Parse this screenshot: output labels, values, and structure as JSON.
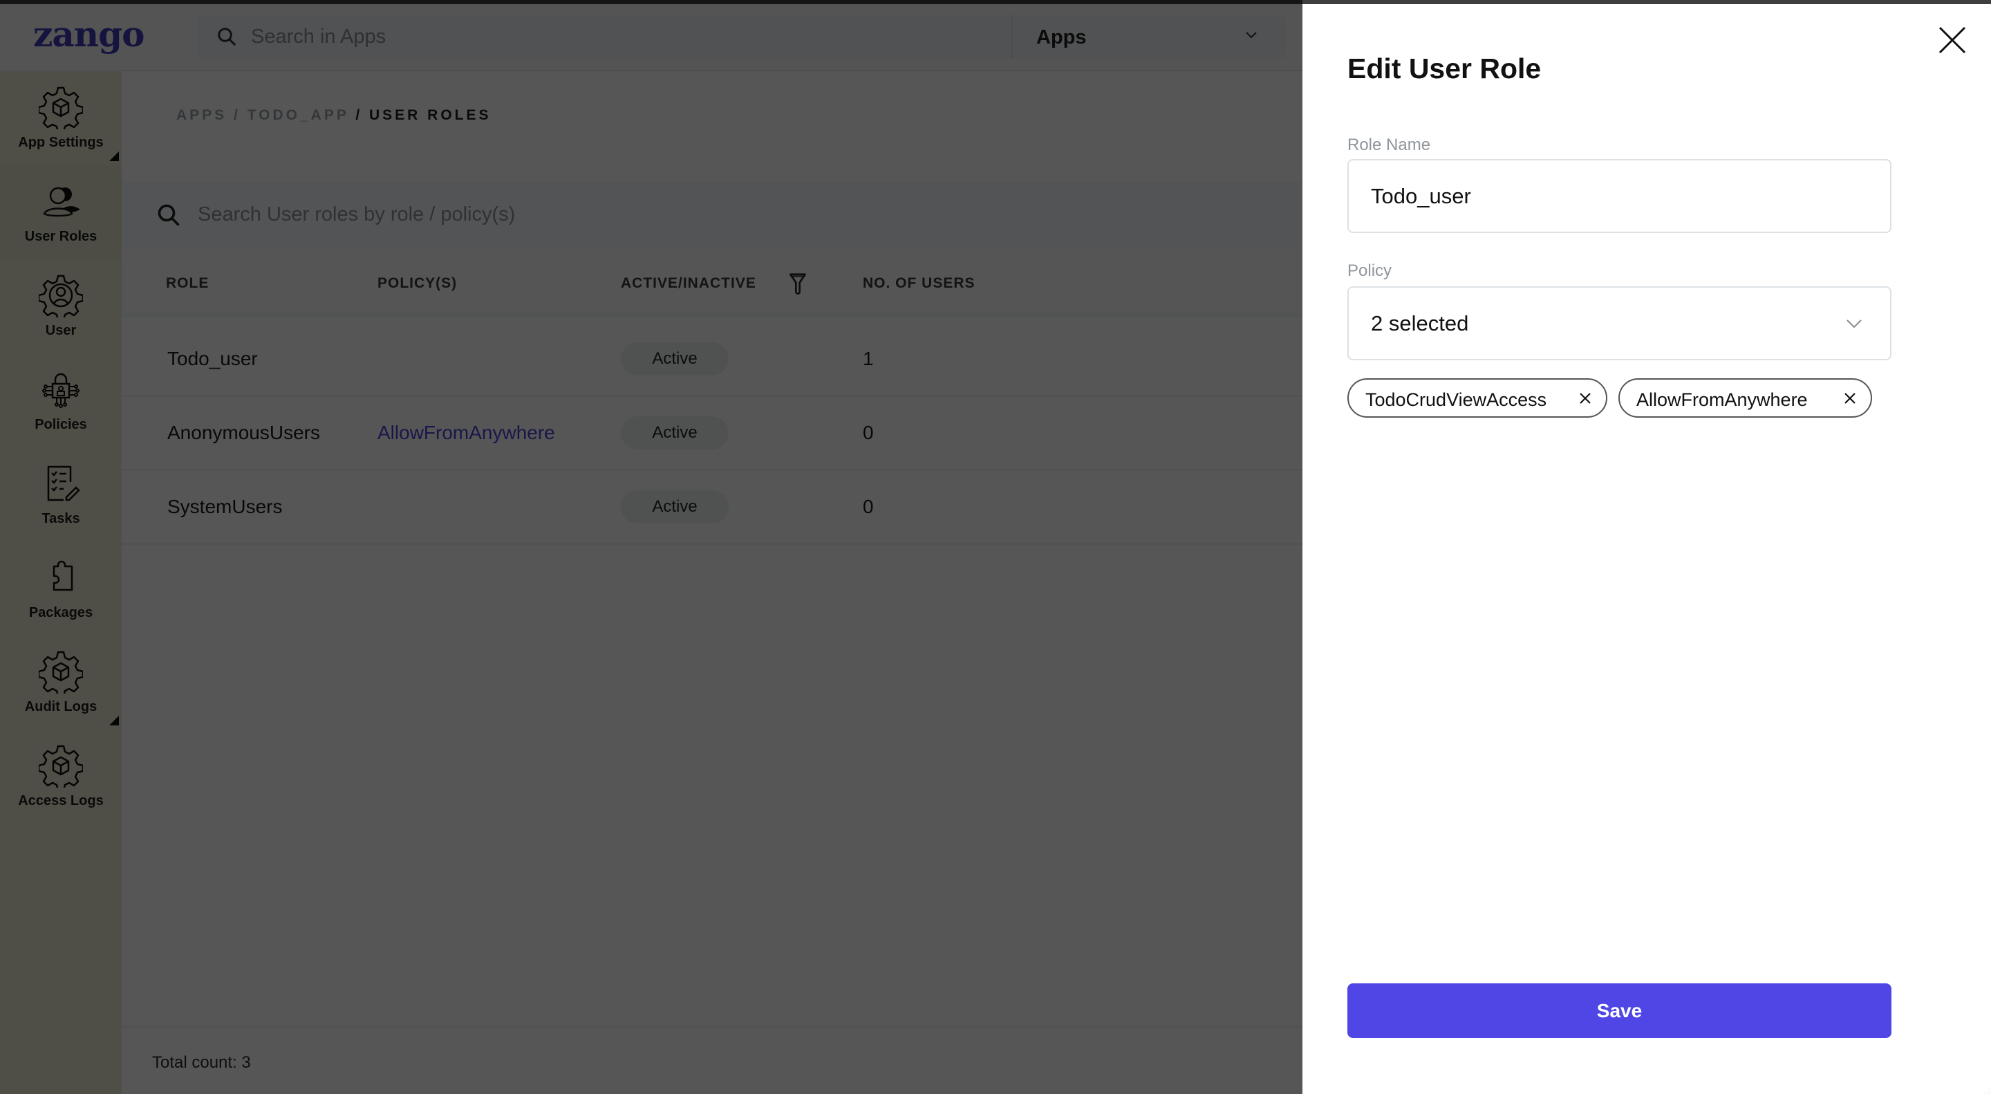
{
  "header": {
    "logo": "zango",
    "search_placeholder": "Search in Apps",
    "apps_select": "Apps"
  },
  "sidebar": {
    "items": [
      {
        "label": "App Settings",
        "icon": "gear-box-icon",
        "active": false,
        "has_submenu": true
      },
      {
        "label": "User Roles",
        "icon": "users-icon",
        "active": true,
        "has_submenu": false
      },
      {
        "label": "User",
        "icon": "gear-user-icon",
        "active": false,
        "has_submenu": false
      },
      {
        "label": "Policies",
        "icon": "lock-circuit-icon",
        "active": false,
        "has_submenu": false
      },
      {
        "label": "Tasks",
        "icon": "checklist-icon",
        "active": false,
        "has_submenu": false
      },
      {
        "label": "Packages",
        "icon": "puzzle-icon",
        "active": false,
        "has_submenu": false
      },
      {
        "label": "Audit Logs",
        "icon": "gear-box-icon",
        "active": false,
        "has_submenu": true
      },
      {
        "label": "Access Logs",
        "icon": "gear-box-icon",
        "active": false,
        "has_submenu": false
      }
    ]
  },
  "breadcrumb": {
    "parts": [
      "APPS",
      "TODO_APP"
    ],
    "separator": " / ",
    "current": "/ USER ROLES"
  },
  "table": {
    "search_placeholder": "Search User roles by role / policy(s)",
    "columns": [
      "ROLE",
      "POLICY(S)",
      "ACTIVE/INACTIVE",
      "NO. OF USERS"
    ],
    "rows": [
      {
        "role": "Todo_user",
        "policies": "",
        "status": "Active",
        "users": "1"
      },
      {
        "role": "AnonymousUsers",
        "policies": "AllowFromAnywhere",
        "status": "Active",
        "users": "0"
      },
      {
        "role": "SystemUsers",
        "policies": "",
        "status": "Active",
        "users": "0"
      }
    ],
    "total_count_label": "Total count: 3"
  },
  "panel": {
    "title": "Edit User Role",
    "role_name_label": "Role Name",
    "role_name_value": "Todo_user",
    "policy_label": "Policy",
    "policy_value": "2 selected",
    "selected_policies": [
      "TodoCrudViewAccess",
      "AllowFromAnywhere"
    ],
    "save_label": "Save"
  },
  "colors": {
    "accent": "#4f46e5",
    "link": "#4a43d8",
    "sidebar_bg": "#e9e6cf",
    "badge_bg": "#e9f1ec"
  }
}
